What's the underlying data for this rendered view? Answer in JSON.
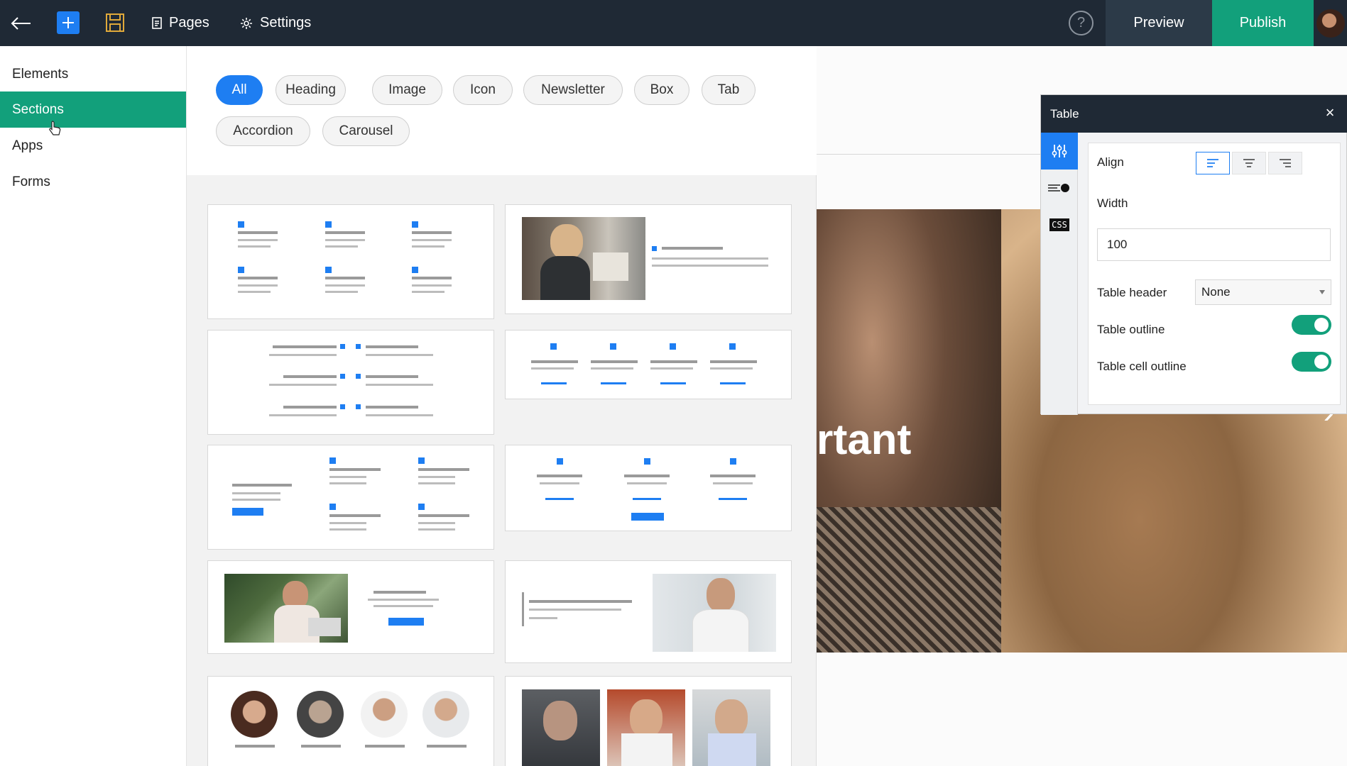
{
  "topbar": {
    "pages_label": "Pages",
    "settings_label": "Settings",
    "help_label": "?",
    "preview_label": "Preview",
    "publish_label": "Publish"
  },
  "leftnav": {
    "items": [
      {
        "label": "Elements",
        "active": false
      },
      {
        "label": "Sections",
        "active": true
      },
      {
        "label": "Apps",
        "active": false
      },
      {
        "label": "Forms",
        "active": false
      }
    ]
  },
  "filters": {
    "chips": [
      "All",
      "Heading",
      "Image",
      "Icon",
      "Newsletter",
      "Box",
      "Tab",
      "Accordion",
      "Carousel"
    ],
    "active": "All"
  },
  "canvas": {
    "hero_text": "rtant",
    "next_arrow": "›"
  },
  "table_panel": {
    "title": "Table",
    "close": "×",
    "tabs": [
      "settings-icon",
      "style-icon",
      "css-icon"
    ],
    "css_tab_label": "CSS",
    "align_label": "Align",
    "align_options": [
      "left",
      "center",
      "right"
    ],
    "align_selected": "left",
    "width_label": "Width",
    "width_value": "100",
    "header_label": "Table header",
    "header_value": "None",
    "outline_label": "Table outline",
    "outline_on": true,
    "cell_outline_label": "Table cell outline",
    "cell_outline_on": true
  },
  "colors": {
    "topbar": "#1f2935",
    "accent_green": "#12a07b",
    "accent_blue": "#1e7ef2"
  }
}
